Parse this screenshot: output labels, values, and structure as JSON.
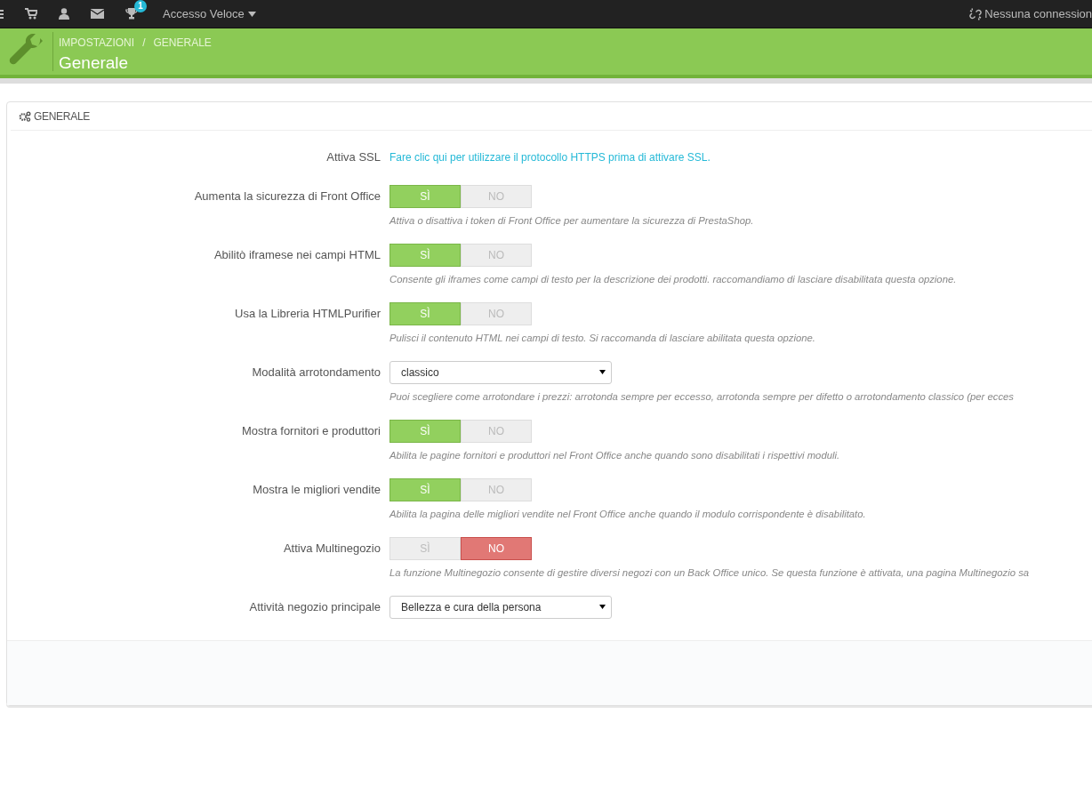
{
  "topbar": {
    "trophy_badge": "1",
    "quick_access": "Accesso Veloce",
    "connection": "Nessuna connession"
  },
  "header": {
    "breadcrumb": [
      "IMPOSTAZIONI",
      "GENERALE"
    ],
    "separator": "/",
    "title": "Generale"
  },
  "panel": {
    "title": "GENERALE",
    "rows": [
      {
        "kind": "link",
        "label": "Attiva SSL",
        "link": "Fare clic qui per utilizzare il protocollo HTTPS prima di attivare SSL."
      },
      {
        "kind": "switch",
        "label": "Aumenta la sicurezza di Front Office",
        "yes": "SÌ",
        "no": "NO",
        "on": true,
        "help": "Attiva o disattiva i token di Front Office per aumentare la sicurezza di PrestaShop."
      },
      {
        "kind": "switch",
        "label": "Abilitò iframese nei campi HTML",
        "yes": "SÌ",
        "no": "NO",
        "on": true,
        "help": "Consente gli iframes come campi di testo per la descrizione dei prodotti. raccomandiamo di lasciare disabilitata questa opzione."
      },
      {
        "kind": "switch",
        "label": "Usa la Libreria HTMLPurifier",
        "yes": "SÌ",
        "no": "NO",
        "on": true,
        "help": "Pulisci il contenuto HTML nei campi di testo. Si raccomanda di lasciare abilitata questa opzione."
      },
      {
        "kind": "select",
        "label": "Modalità arrotondamento",
        "value": "classico",
        "help": "Puoi scegliere come arrotondare i prezzi: arrotonda sempre per eccesso, arrotonda sempre per difetto o arrotondamento classico (per ecces"
      },
      {
        "kind": "switch",
        "label": "Mostra fornitori e produttori",
        "yes": "SÌ",
        "no": "NO",
        "on": true,
        "help": "Abilita le pagine fornitori e produttori nel Front Office anche quando sono disabilitati i rispettivi moduli."
      },
      {
        "kind": "switch",
        "label": "Mostra le migliori vendite",
        "yes": "SÌ",
        "no": "NO",
        "on": true,
        "help": "Abilita la pagina delle migliori vendite nel Front Office anche quando il modulo corrispondente è disabilitato."
      },
      {
        "kind": "switch",
        "label": "Attiva Multinegozio",
        "yes": "SÌ",
        "no": "NO",
        "on": false,
        "help": "La funzione Multinegozio consente di gestire diversi negozi con un Back Office unico. Se questa funzione è attivata, una pagina Multinegozio sa"
      },
      {
        "kind": "select",
        "label": "Attività negozio principale",
        "value": "Bellezza e cura della persona"
      }
    ]
  }
}
